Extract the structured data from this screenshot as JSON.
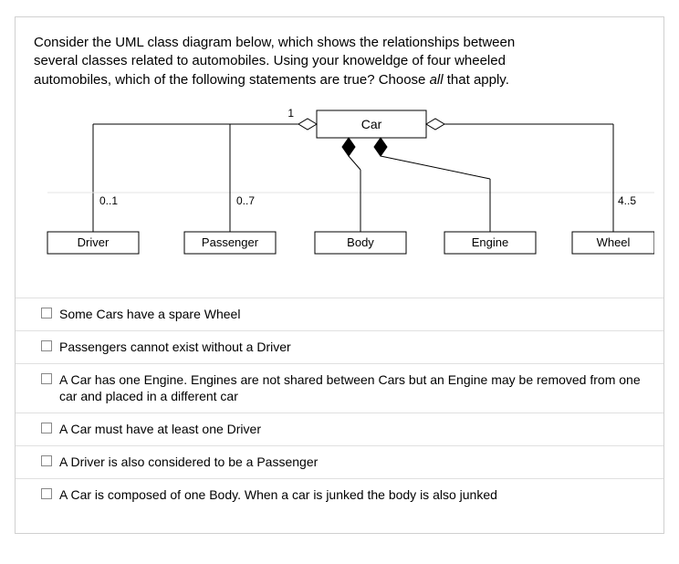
{
  "question": {
    "line1": "Consider the UML class diagram below, which shows the relationships between",
    "line2": "several classes related to automobiles. Using your knoweldge of four wheeled",
    "line3_pre": "automobiles, which of the following statements are true?  Choose ",
    "line3_italic": "all",
    "line3_post": " that apply."
  },
  "diagram": {
    "car": "Car",
    "driver": "Driver",
    "passenger": "Passenger",
    "body": "Body",
    "engine": "Engine",
    "wheel": "Wheel",
    "mult_driver": "0..1",
    "mult_passenger": "0..7",
    "mult_car": "1",
    "mult_wheel": "4..5"
  },
  "options": [
    {
      "text": "Some Cars have a spare Wheel"
    },
    {
      "text": "Passengers cannot exist without a Driver"
    },
    {
      "text": "A Car has one Engine. Engines are not shared between Cars but an Engine may be removed from one car and placed in a different car"
    },
    {
      "text": "A Car must have at least one Driver"
    },
    {
      "text": "A Driver is also considered to be a Passenger"
    },
    {
      "text": "A Car is composed of one Body. When a car is junked the body is also junked"
    }
  ]
}
